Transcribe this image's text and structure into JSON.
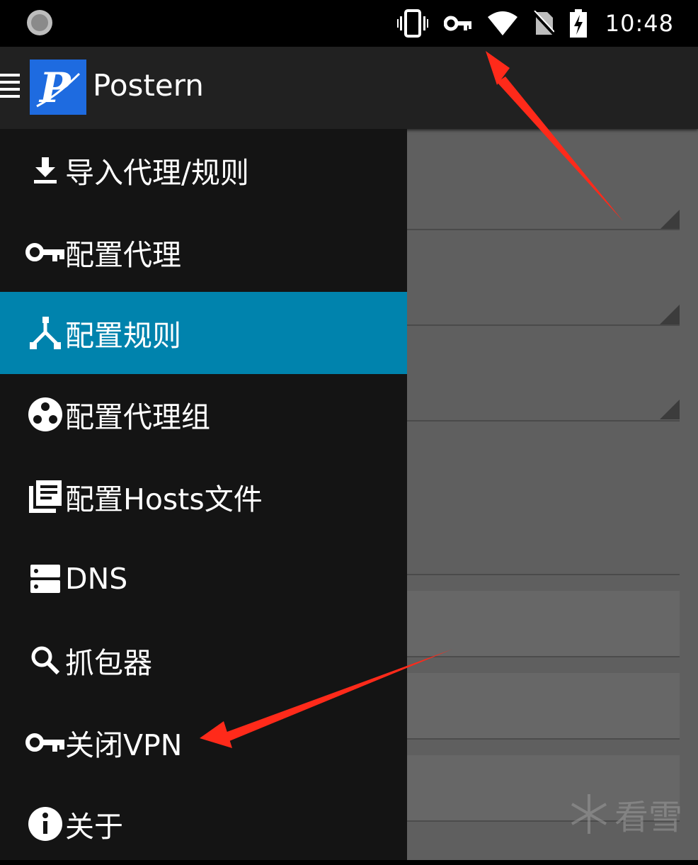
{
  "status_bar": {
    "time": "10:48",
    "icons": [
      "vibrate-icon",
      "vpn-key-icon",
      "wifi-icon",
      "no-sim-icon",
      "battery-charging-icon"
    ]
  },
  "app_bar": {
    "title": "Postern",
    "logo_letter": "P"
  },
  "drawer": {
    "items": [
      {
        "label": "导入代理/规则",
        "icon": "download-icon"
      },
      {
        "label": "配置代理",
        "icon": "key-icon"
      },
      {
        "label": "配置规则",
        "icon": "rules-icon",
        "selected": true
      },
      {
        "label": "配置代理组",
        "icon": "proxy-group-icon"
      },
      {
        "label": "配置Hosts文件",
        "icon": "hosts-file-icon"
      },
      {
        "label": "DNS",
        "icon": "dns-icon"
      },
      {
        "label": "抓包器",
        "icon": "search-icon"
      },
      {
        "label": "关闭VPN",
        "icon": "key-icon"
      },
      {
        "label": "关于",
        "icon": "info-icon"
      }
    ]
  },
  "watermark": {
    "text": "看雪"
  },
  "colors": {
    "selected": "#0083ad",
    "drawer_bg": "#141414",
    "app_bar": "#212121",
    "annotation_arrow": "#ff2a1a"
  }
}
